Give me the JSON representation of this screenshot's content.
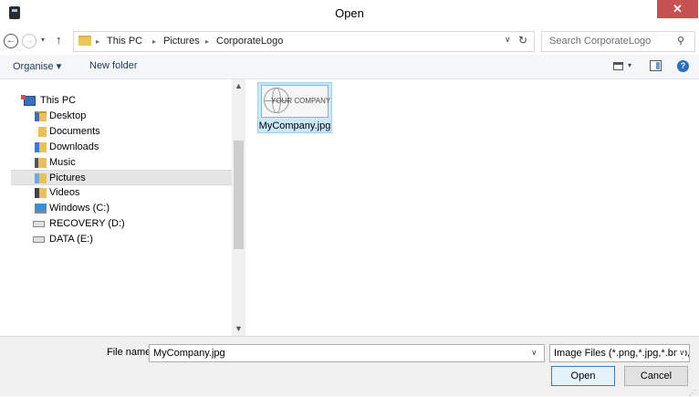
{
  "window": {
    "title": "Open",
    "close_glyph": "✕"
  },
  "nav": {
    "back_glyph": "←",
    "forward_glyph": "→",
    "recent_glyph": "▾",
    "up_glyph": "↑",
    "breadcrumb": [
      "This PC",
      "Pictures",
      "CorporateLogo"
    ],
    "separator": "▸",
    "dropdown_glyph": "∨",
    "refresh_glyph": "↻",
    "search_placeholder": "Search CorporateLogo",
    "search_glyph": "⚲"
  },
  "toolbar": {
    "organise": "Organise ▾",
    "new_folder": "New folder",
    "view_dd": "▾",
    "help": "?"
  },
  "sidebar": {
    "items": [
      {
        "label": "This PC",
        "icon": "this-pc-icon"
      },
      {
        "label": "Desktop",
        "icon": "desktop-folder-icon"
      },
      {
        "label": "Documents",
        "icon": "documents-folder-icon"
      },
      {
        "label": "Downloads",
        "icon": "downloads-folder-icon"
      },
      {
        "label": "Music",
        "icon": "music-folder-icon"
      },
      {
        "label": "Pictures",
        "icon": "pictures-folder-icon",
        "selected": true
      },
      {
        "label": "Videos",
        "icon": "videos-folder-icon"
      },
      {
        "label": "Windows (C:)",
        "icon": "windows-drive-icon"
      },
      {
        "label": "RECOVERY (D:)",
        "icon": "drive-icon"
      },
      {
        "label": "DATA (E:)",
        "icon": "drive-icon"
      }
    ],
    "scroll_up": "▲",
    "scroll_down": "▼"
  },
  "files": [
    {
      "name": "MyCompany.jpg",
      "thumbnail_text": "YOUR COMPANY"
    }
  ],
  "footer": {
    "file_name_label": "File name:",
    "file_name_value": "MyCompany.jpg",
    "file_name_dd": "∨",
    "file_type_value": "Image Files (*.png,*.jpg,*.bmp,*.gif)",
    "file_type_dd": "∨",
    "open_label": "Open",
    "cancel_label": "Cancel",
    "grip": "⋰"
  },
  "colors": {
    "close_button": "#c75050",
    "selection": "#cce8ff",
    "link_text": "#1e395b"
  }
}
